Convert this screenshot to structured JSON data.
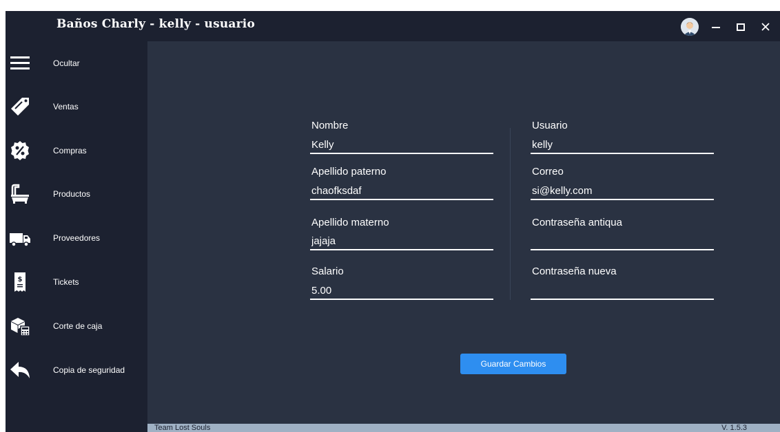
{
  "window": {
    "title": "Baños Charly - kelly - usuario",
    "controls": {
      "minimize": "–",
      "maximize": "□",
      "close": "✕"
    }
  },
  "sidebar": {
    "items": [
      {
        "label": "Ocultar",
        "icon": "menu-icon"
      },
      {
        "label": "Ventas",
        "icon": "sale-tag-icon"
      },
      {
        "label": "Compras",
        "icon": "discount-badge-icon"
      },
      {
        "label": "Productos",
        "icon": "bathtub-icon"
      },
      {
        "label": "Proveedores",
        "icon": "delivery-truck-icon"
      },
      {
        "label": "Tickets",
        "icon": "receipt-icon"
      },
      {
        "label": "Corte de caja",
        "icon": "cash-boxes-icon"
      },
      {
        "label": "Copia de seguridad",
        "icon": "back-arrow-icon"
      }
    ]
  },
  "form": {
    "nombre": {
      "label": "Nombre",
      "value": "Kelly"
    },
    "apellido_paterno": {
      "label": "Apellido paterno",
      "value": "chaofksdaf"
    },
    "apellido_materno": {
      "label": "Apellido materno",
      "value": "jajaja"
    },
    "salario": {
      "label": "Salario",
      "value": "5.00"
    },
    "usuario": {
      "label": "Usuario",
      "value": "kelly"
    },
    "correo": {
      "label": "Correo",
      "value": "si@kelly.com"
    },
    "contrasena_antigua": {
      "label": "Contraseña antiqua",
      "value": ""
    },
    "contrasena_nueva": {
      "label": "Contraseña nueva",
      "value": ""
    },
    "save_label": "Guardar Cambios"
  },
  "status": {
    "left": "Team Lost Souls",
    "right": "V. 1.5.3"
  },
  "colors": {
    "sidebar": "#1c2130",
    "main": "#2a3242",
    "accent": "#2e8ef0",
    "statusbar": "#9fb1c4"
  }
}
